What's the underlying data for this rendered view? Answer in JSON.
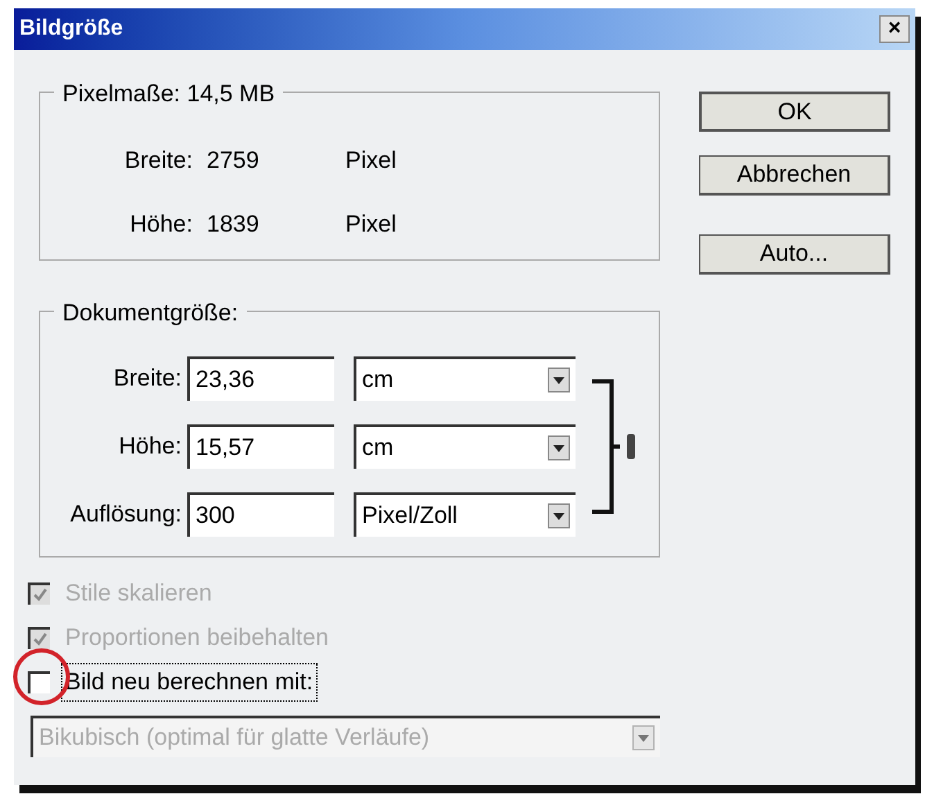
{
  "window": {
    "title": "Bildgröße",
    "close": "×"
  },
  "pixel_dimensions": {
    "title": "Pixelmaße: 14,5 MB",
    "rows": [
      {
        "label": "Breite:",
        "value": "2759",
        "unit": "Pixel"
      },
      {
        "label": "Höhe:",
        "value": "1839",
        "unit": "Pixel"
      }
    ]
  },
  "document_size": {
    "title": "Dokumentgröße:",
    "rows": [
      {
        "label": "Breite:",
        "value": "23,36",
        "unit": "cm"
      },
      {
        "label": "Höhe:",
        "value": "15,57",
        "unit": "cm"
      },
      {
        "label": "Auflösung:",
        "value": "300",
        "unit": "Pixel/Zoll"
      }
    ]
  },
  "buttons": [
    {
      "label": "OK",
      "default": true
    },
    {
      "label": "Abbrechen",
      "default": false
    },
    {
      "label": "Auto...",
      "default": false
    }
  ],
  "options": [
    {
      "label": "Stile skalieren",
      "checked": true,
      "disabled": true,
      "focused": false
    },
    {
      "label": "Proportionen beibehalten",
      "checked": true,
      "disabled": true,
      "focused": false
    },
    {
      "label": "Bild neu berechnen mit:",
      "checked": false,
      "disabled": false,
      "focused": true
    }
  ],
  "resample": {
    "value": "Bikubisch (optimal für glatte Verläufe)",
    "disabled": true
  }
}
